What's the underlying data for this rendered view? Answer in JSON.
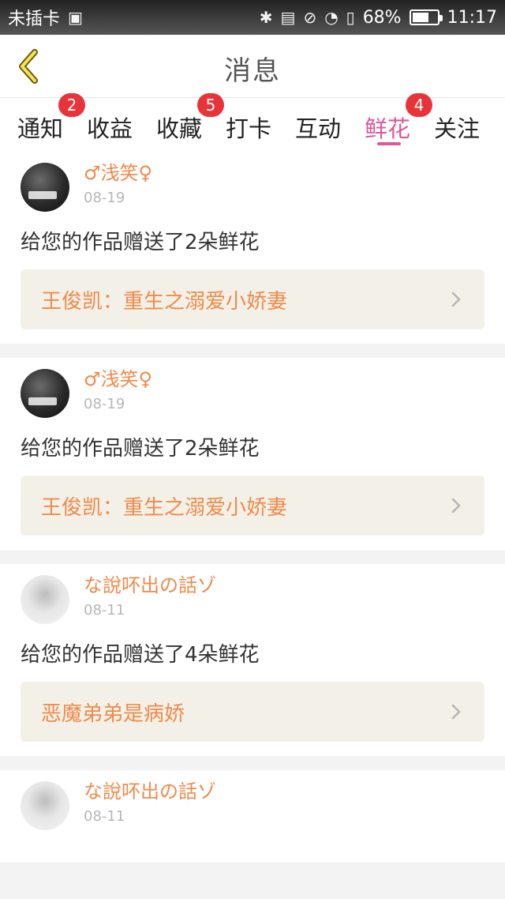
{
  "status_bar": {
    "carrier": "未插卡",
    "battery_percent": "68%",
    "battery_level": 0.68,
    "time": "11:17",
    "icons": [
      "image-icon",
      "bluetooth-icon",
      "nfc-icon",
      "vibrate-icon",
      "wifi-icon",
      "sim-icon",
      "battery-icon"
    ]
  },
  "header": {
    "title": "消息",
    "back_icon": "chevron-left-icon"
  },
  "tabs": [
    {
      "label": "通知",
      "badge": "2"
    },
    {
      "label": "收益",
      "badge": ""
    },
    {
      "label": "收藏",
      "badge": "5"
    },
    {
      "label": "打卡",
      "badge": ""
    },
    {
      "label": "互动",
      "badge": ""
    },
    {
      "label": "鲜花",
      "badge": "4",
      "active": true
    },
    {
      "label": "关注",
      "badge": ""
    }
  ],
  "colors": {
    "accent_pink": "#e0569a",
    "name_orange": "#f08a4b",
    "badge_red": "#e8333a",
    "link_bg": "#f3f1e7"
  },
  "items": [
    {
      "user": "♂浅笑♀",
      "date": "08-19",
      "message": "给您的作品赠送了2朵鲜花",
      "work": "王俊凯：重生之溺爱小娇妻"
    },
    {
      "user": "♂浅笑♀",
      "date": "08-19",
      "message": "给您的作品赠送了2朵鲜花",
      "work": "王俊凯：重生之溺爱小娇妻"
    },
    {
      "user": "な說吥出の話ゾ",
      "date": "08-11",
      "message": "给您的作品赠送了4朵鲜花",
      "work": "恶魔弟弟是病娇"
    },
    {
      "user": "な說吥出の話ゾ",
      "date": "08-11",
      "message": "",
      "work": ""
    }
  ]
}
